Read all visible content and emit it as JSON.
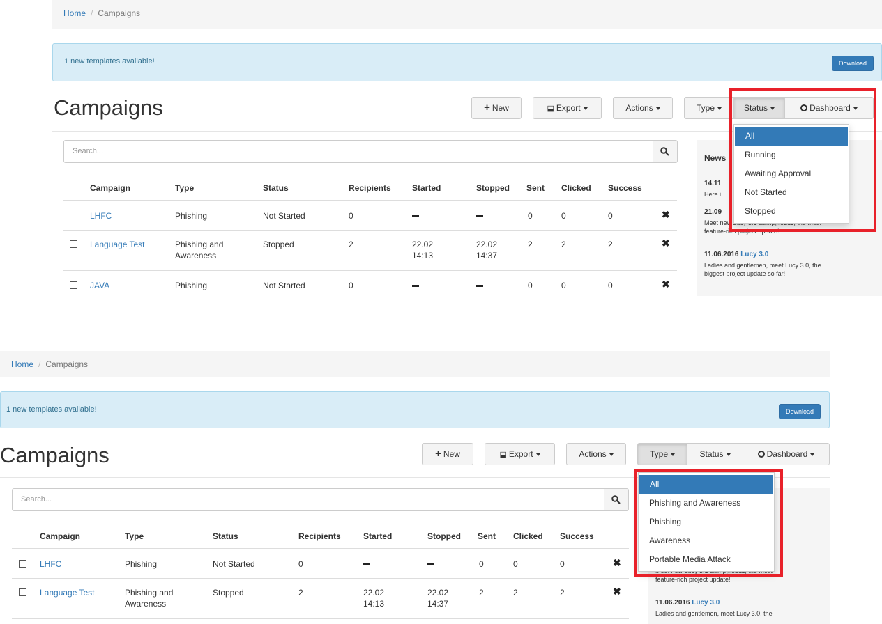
{
  "breadcrumb": {
    "home": "Home",
    "separator": "/",
    "current": "Campaigns"
  },
  "alert": {
    "message": "1 new templates available!",
    "button": "Download"
  },
  "page_title": "Campaigns",
  "toolbar": {
    "new": "New",
    "export": "Export",
    "actions": "Actions",
    "type": "Type",
    "status": "Status",
    "dashboard": "Dashboard"
  },
  "search": {
    "placeholder": "Search..."
  },
  "table": {
    "columns": [
      "Campaign",
      "Type",
      "Status",
      "Recipients",
      "Started",
      "Stopped",
      "Sent",
      "Clicked",
      "Success"
    ],
    "rows": [
      {
        "name": "LHFC",
        "type": "Phishing",
        "status": "Not Started",
        "recipients": "0",
        "started": "",
        "stopped": "",
        "sent": "0",
        "clicked": "0",
        "success": "0"
      },
      {
        "name": "Language Test",
        "type_line1": "Phishing and",
        "type_line2": "Awareness",
        "status": "Stopped",
        "recipients": "2",
        "started_date": "22.02",
        "started_time": "14:13",
        "stopped_date": "22.02",
        "stopped_time": "14:37",
        "sent": "2",
        "clicked": "2",
        "success": "2"
      },
      {
        "name": "JAVA",
        "type": "Phishing",
        "status": "Not Started",
        "recipients": "0",
        "started": "",
        "stopped": "",
        "sent": "0",
        "clicked": "0",
        "success": "0"
      }
    ]
  },
  "news": {
    "heading": "News",
    "items": [
      {
        "date_fragment": "14.11",
        "text_fragment": "Here i"
      },
      {
        "date_fragment": "21.09",
        "text_line1": "Meet new Lucy 3.1 &amp;#8211; the most",
        "text_line2": "feature-rich project update!"
      },
      {
        "date": "11.06.2016",
        "link": "Lucy 3.0",
        "text_line1": "Ladies and gentlemen, meet Lucy 3.0, the",
        "text_line2": "biggest project update so far!"
      }
    ]
  },
  "status_dropdown": {
    "items": [
      "All",
      "Running",
      "Awaiting Approval",
      "Not Started",
      "Stopped"
    ],
    "selected": "All"
  },
  "type_dropdown": {
    "items": [
      "All",
      "Phishing and Awareness",
      "Phishing",
      "Awareness",
      "Portable Media Attack"
    ],
    "selected": "All"
  },
  "colors": {
    "highlight": "#e8212a",
    "link": "#337ab7",
    "alert_bg": "#d9edf7",
    "dropdown_selected": "#337ab7"
  }
}
